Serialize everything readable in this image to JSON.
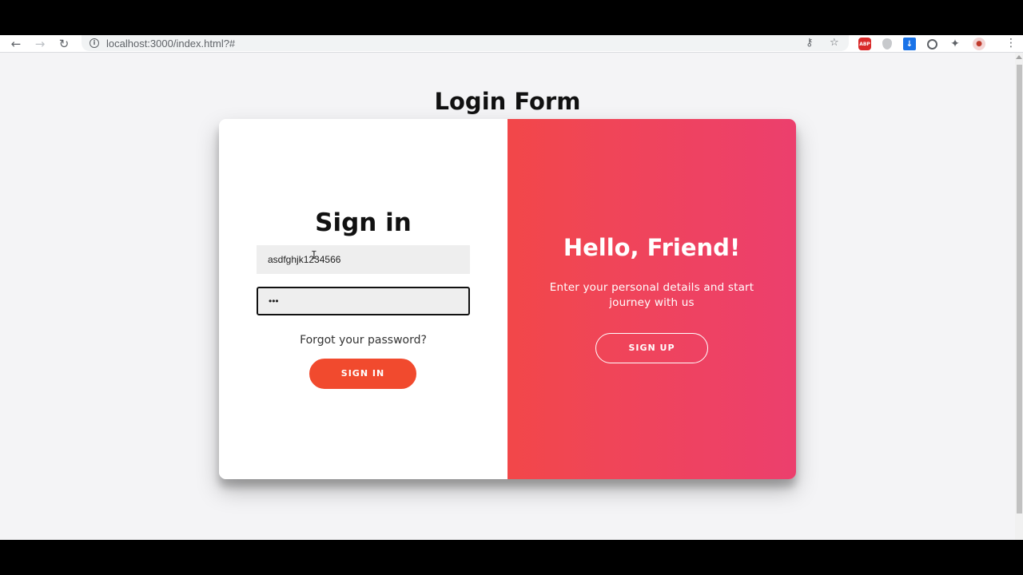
{
  "browser": {
    "url": "localhost:3000/index.html?#",
    "icons": {
      "back": "arrow-left-icon",
      "forward": "arrow-right-icon",
      "reload": "reload-icon",
      "info": "info-icon",
      "key": "key-icon",
      "star": "bookmark-star-icon",
      "extensions": [
        "adblock-plus-icon",
        "shield-icon",
        "download-icon",
        "extension-circle-icon",
        "puzzle-icon",
        "profile-avatar-icon"
      ],
      "menu": "kebab-menu-icon"
    },
    "abp_label": "ABP"
  },
  "page": {
    "title": "Login Form"
  },
  "signin": {
    "title": "Sign in",
    "email_value": "asdfghjk1234566",
    "password_value": "•••",
    "forgot_link": "Forgot your password?",
    "button_label": "SIGN IN"
  },
  "overlay": {
    "title": "Hello, Friend!",
    "text": "Enter your personal details and start journey with us",
    "button_label": "SIGN UP"
  },
  "colors": {
    "accent": "#f14a2e",
    "gradient_start": "#f24749",
    "gradient_end": "#ec3f6d",
    "page_background": "#f4f4f6"
  }
}
